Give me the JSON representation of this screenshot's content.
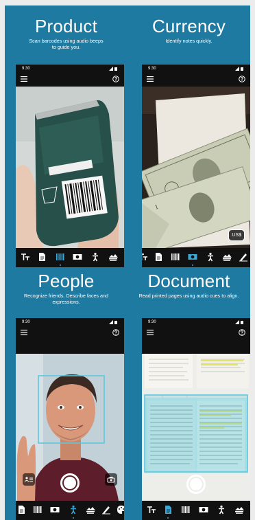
{
  "cards": [
    {
      "title": "Product",
      "subtitle": "Scan barcodes using audio beeps to guide you."
    },
    {
      "title": "Currency",
      "subtitle": "Identify notes quickly."
    },
    {
      "title": "People",
      "subtitle": "Recognize friends. Describe faces and expressions."
    },
    {
      "title": "Document",
      "subtitle": "Read printed pages using audio cues to align."
    }
  ],
  "status_time": "9:30",
  "currency_badge": "US$",
  "colors": {
    "panel": "#1f7aa2",
    "highlight": "#5cc8dd",
    "accent_blue": "#2f8fc0"
  },
  "icons": [
    "menu-icon",
    "help-icon",
    "short-text-icon",
    "document-icon",
    "barcode-icon",
    "currency-icon",
    "person-icon",
    "scene-icon",
    "handwriting-icon",
    "color-icon"
  ]
}
